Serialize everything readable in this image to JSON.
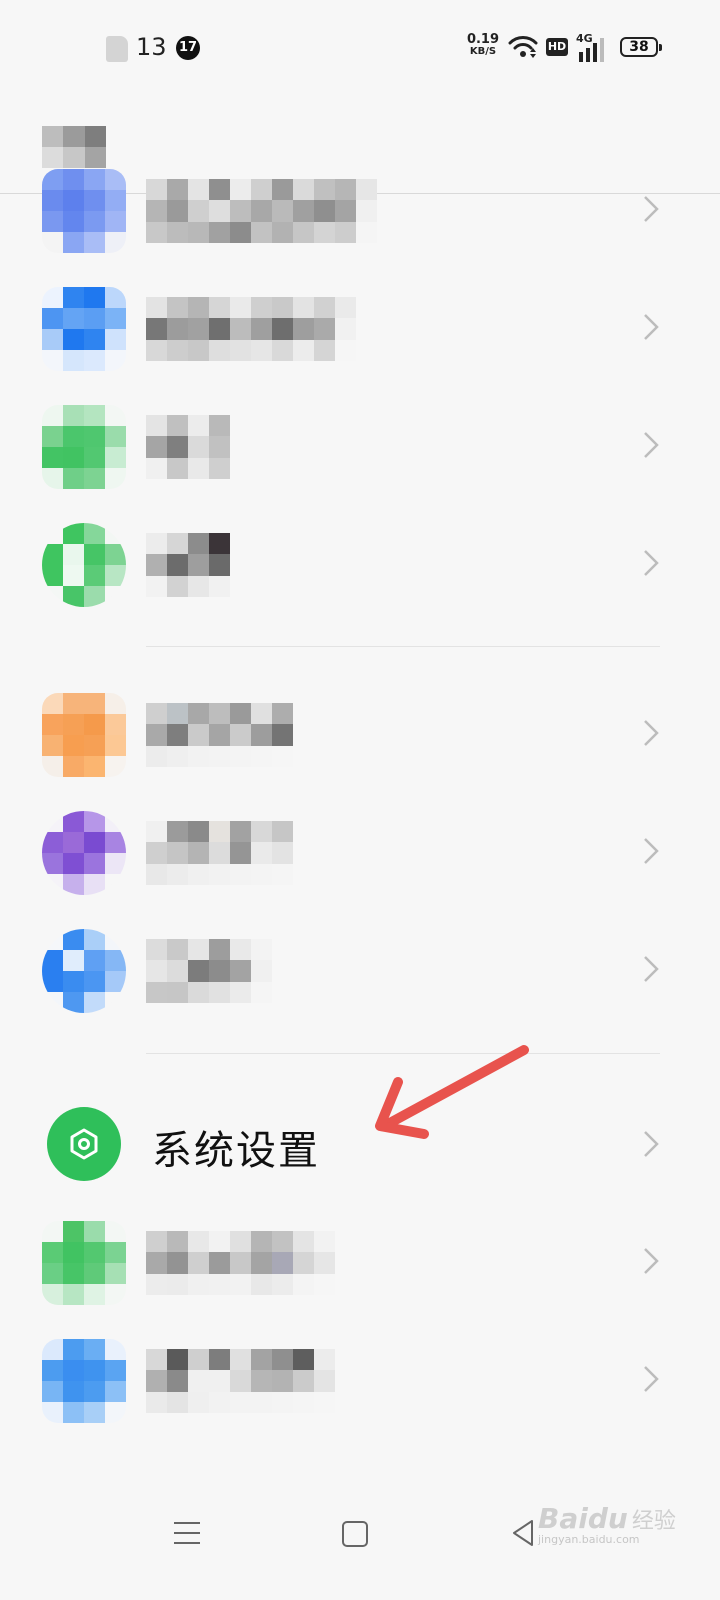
{
  "status_bar": {
    "time": "13",
    "notification_count": "17",
    "net_speed_value": "0.19",
    "net_speed_unit": "KB/S",
    "hd_label": "HD",
    "network_type": "4G",
    "battery_level": "38"
  },
  "highlighted_item": {
    "label": "系统设置",
    "icon": "settings-hexagon-icon",
    "icon_color": "#2fbf5a"
  },
  "annotation": {
    "arrow_color": "#e8534d"
  },
  "list_item_icon_colors": [
    "#6f8fef",
    "#2f84f0",
    "#4bc66c",
    "#3fc560",
    "#f7a154",
    "#9a6ad8",
    "#3a8cf0",
    "#4dc466",
    "#4c9cf0"
  ],
  "nav_bar": {
    "buttons": [
      "menu-icon",
      "home-icon",
      "back-icon"
    ]
  },
  "watermark": {
    "logo": "Baidu",
    "logo_cn": "经验",
    "url": "jingyan.baidu.com"
  }
}
